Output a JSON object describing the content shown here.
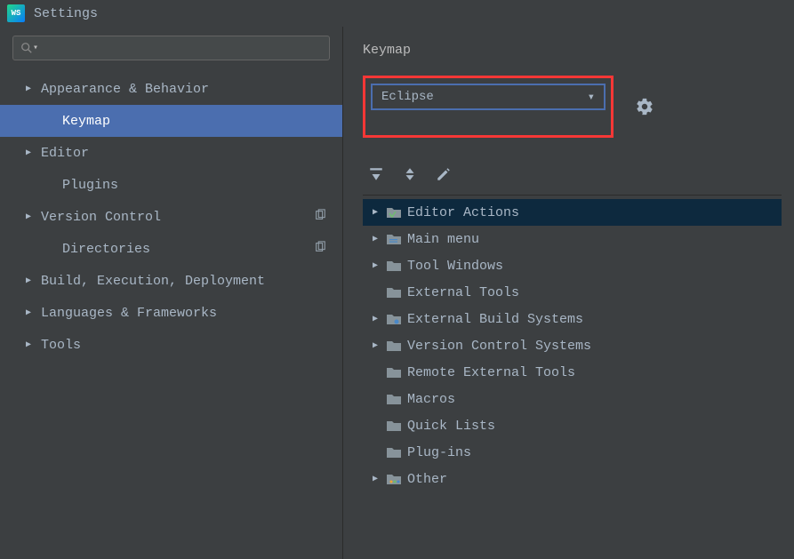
{
  "window": {
    "title": "Settings"
  },
  "search": {
    "placeholder": ""
  },
  "sidebar": {
    "items": [
      {
        "label": "Appearance & Behavior",
        "expandable": true,
        "child": false,
        "selected": false,
        "copyIcon": false
      },
      {
        "label": "Keymap",
        "expandable": false,
        "child": true,
        "selected": true,
        "copyIcon": false
      },
      {
        "label": "Editor",
        "expandable": true,
        "child": false,
        "selected": false,
        "copyIcon": false
      },
      {
        "label": "Plugins",
        "expandable": false,
        "child": true,
        "selected": false,
        "copyIcon": false
      },
      {
        "label": "Version Control",
        "expandable": true,
        "child": false,
        "selected": false,
        "copyIcon": true
      },
      {
        "label": "Directories",
        "expandable": false,
        "child": true,
        "selected": false,
        "copyIcon": true
      },
      {
        "label": "Build, Execution, Deployment",
        "expandable": true,
        "child": false,
        "selected": false,
        "copyIcon": false
      },
      {
        "label": "Languages & Frameworks",
        "expandable": true,
        "child": false,
        "selected": false,
        "copyIcon": false
      },
      {
        "label": "Tools",
        "expandable": true,
        "child": false,
        "selected": false,
        "copyIcon": false
      }
    ]
  },
  "panel": {
    "title": "Keymap",
    "dropdown": {
      "value": "Eclipse"
    }
  },
  "actions": [
    {
      "label": "Editor Actions",
      "expandable": true,
      "selected": true,
      "iconType": "editor"
    },
    {
      "label": "Main menu",
      "expandable": true,
      "selected": false,
      "iconType": "menu"
    },
    {
      "label": "Tool Windows",
      "expandable": true,
      "selected": false,
      "iconType": "folder"
    },
    {
      "label": "External Tools",
      "expandable": false,
      "selected": false,
      "iconType": "folder"
    },
    {
      "label": "External Build Systems",
      "expandable": true,
      "selected": false,
      "iconType": "folder-gear"
    },
    {
      "label": "Version Control Systems",
      "expandable": true,
      "selected": false,
      "iconType": "folder"
    },
    {
      "label": "Remote External Tools",
      "expandable": false,
      "selected": false,
      "iconType": "folder"
    },
    {
      "label": "Macros",
      "expandable": false,
      "selected": false,
      "iconType": "folder"
    },
    {
      "label": "Quick Lists",
      "expandable": false,
      "selected": false,
      "iconType": "folder"
    },
    {
      "label": "Plug-ins",
      "expandable": false,
      "selected": false,
      "iconType": "folder"
    },
    {
      "label": "Other",
      "expandable": true,
      "selected": false,
      "iconType": "other"
    }
  ]
}
